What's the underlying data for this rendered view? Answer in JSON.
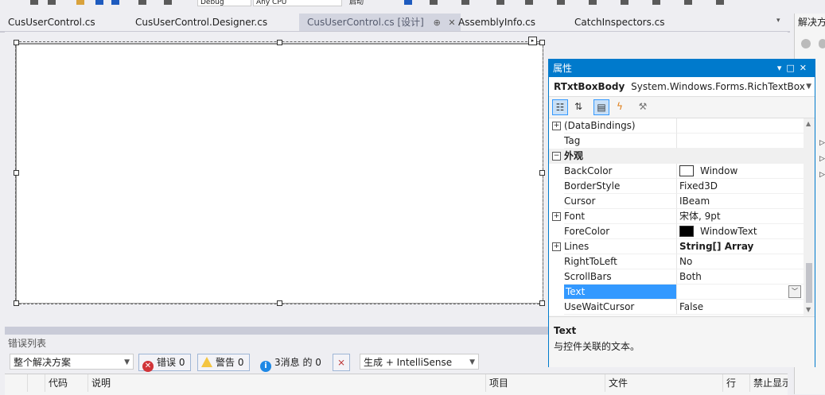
{
  "toolbar": {
    "config_combo": "Debug",
    "platform_combo": "Any CPU",
    "start_label": "启动"
  },
  "tabs": [
    {
      "label": "CusUserControl.cs"
    },
    {
      "label": "CusUserControl.Designer.cs"
    },
    {
      "label": "CusUserControl.cs [设计]",
      "pin": "⊕",
      "close": "✕"
    },
    {
      "label": "AssemblyInfo.cs"
    },
    {
      "label": "CatchInspectors.cs"
    }
  ],
  "solution_explorer": {
    "title": "解决方"
  },
  "error_list": {
    "title": "错误列表",
    "scope": "整个解决方案",
    "errors": "错误 0",
    "warnings": "警告 0",
    "messages": "3消息 的 0",
    "build_filter": "生成 + IntelliSense",
    "columns": [
      "代码",
      "说明",
      "项目",
      "文件",
      "行",
      "禁止显示"
    ]
  },
  "properties": {
    "title": "属性",
    "object_name": "RTxtBoxBody",
    "object_type": "System.Windows.Forms.RichTextBox",
    "rows": [
      {
        "name": "(DataBindings)",
        "value": "",
        "expander": "+"
      },
      {
        "name": "Tag",
        "value": ""
      },
      {
        "name": "外观",
        "value": "",
        "expander": "−",
        "category": true
      },
      {
        "name": "BackColor",
        "value": "Window",
        "swatch": "#ffffff"
      },
      {
        "name": "BorderStyle",
        "value": "Fixed3D"
      },
      {
        "name": "Cursor",
        "value": "IBeam"
      },
      {
        "name": "Font",
        "value": "宋体, 9pt",
        "expander": "+"
      },
      {
        "name": "ForeColor",
        "value": "WindowText",
        "swatch": "#000000"
      },
      {
        "name": "Lines",
        "value": "String[] Array",
        "expander": "+",
        "bold": true
      },
      {
        "name": "RightToLeft",
        "value": "No"
      },
      {
        "name": "ScrollBars",
        "value": "Both"
      },
      {
        "name": "Text",
        "value": "",
        "selected": true
      },
      {
        "name": "UseWaitCursor",
        "value": "False"
      }
    ],
    "desc_title": "Text",
    "desc_text": "与控件关联的文本。"
  },
  "colors": {
    "accent": "#007acc",
    "selection": "#3399ff",
    "error": "#d13438",
    "warning": "#f4c542",
    "info": "#1e88e5"
  }
}
